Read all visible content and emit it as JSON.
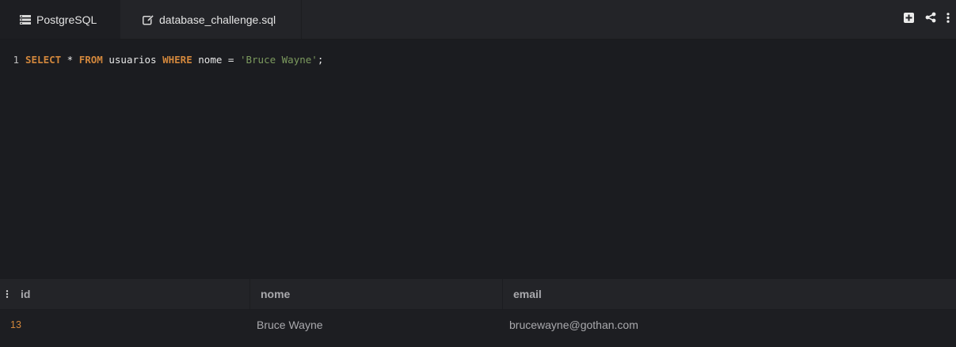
{
  "tabs": [
    {
      "label": "PostgreSQL",
      "icon": "list-icon"
    },
    {
      "label": "database_challenge.sql",
      "icon": "edit-icon"
    }
  ],
  "toolbar": {
    "icons": [
      "add-box-icon",
      "share-icon",
      "more-vertical-icon"
    ]
  },
  "editor": {
    "line_number": "1",
    "tokens": {
      "select": "SELECT",
      "star": " * ",
      "from": "FROM",
      "table": " usuarios ",
      "where": "WHERE",
      "cond": " nome = ",
      "string": "'Bruce Wayne'",
      "end": ";"
    }
  },
  "results": {
    "columns": [
      "id",
      "nome",
      "email"
    ],
    "rows": [
      {
        "id": "13",
        "nome": "Bruce Wayne",
        "email": "brucewayne@gothan.com"
      }
    ]
  },
  "colors": {
    "background": "#1b1c20",
    "keyword": "#d2873c",
    "string": "#7c9a5e",
    "header_bg": "#232428"
  }
}
